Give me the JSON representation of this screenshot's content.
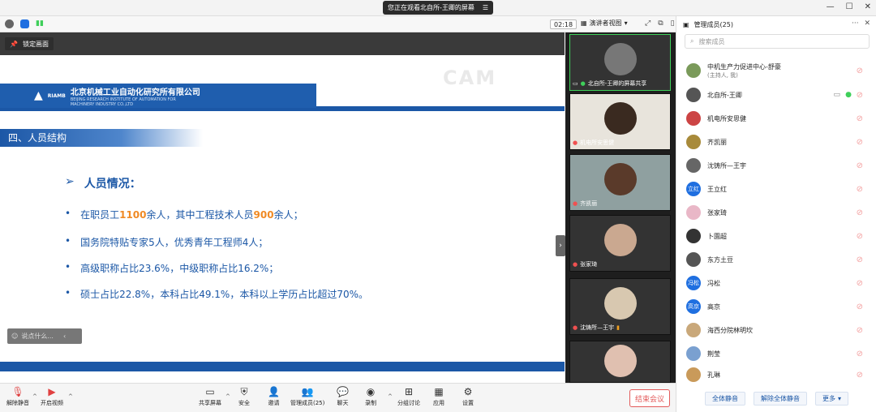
{
  "titlebar": {
    "watching": "您正在观看北自所-王卿的屏幕",
    "menu_icon": "menu-icon"
  },
  "toolbar": {
    "timer": "02:18",
    "view_mode": "演讲者视图"
  },
  "stage": {
    "lock_label": "锁定画面",
    "chat_placeholder": "说点什么..."
  },
  "slide": {
    "company_cn": "北京机械工业自动化研究所有限公司",
    "company_en1": "BEIJING RESEARCH INSTITUTE OF AUTOMATION FOR",
    "company_en2": "MACHINERY INDUSTRY CO.,LTD",
    "logo_text": "RIAMB",
    "watermark": "CAM",
    "section": "四、人员结构",
    "heading_marker": "➢",
    "heading": "人员情况：",
    "bullet_marker": "•",
    "b1_pre": "在职员工",
    "b1_n1": "1100",
    "b1_mid": "余人，其中工程技术人员",
    "b1_n2": "900",
    "b1_post": "余人；",
    "b2": "国务院特贴专家5人，优秀青年工程师4人；",
    "b3": "高级职称占比23.6%，中级职称占比16.2%；",
    "b4": "硕士占比22.8%，本科占比49.1%，本科以上学历占比超过70%。"
  },
  "videos": [
    {
      "label": "北自所-王卿的屏幕共享"
    },
    {
      "label": "机电所安思健"
    },
    {
      "label": "齐凯丽"
    },
    {
      "label": "张家琦"
    },
    {
      "label": "沈铸所—王宇"
    },
    {
      "label": ""
    }
  ],
  "panel": {
    "title": "管理成员(25)",
    "search_placeholder": "搜索成员",
    "members": [
      {
        "name": "中机生产力促进中心-舒豪",
        "sub": "(主持人, 我)",
        "color": "#7a9a5a"
      },
      {
        "name": "北自所-王卿",
        "sub": "",
        "color": "#555"
      },
      {
        "name": "机电所安思健",
        "sub": "",
        "color": "#c44"
      },
      {
        "name": "齐凯丽",
        "sub": "",
        "color": "#a88a3a"
      },
      {
        "name": "沈铸所—王宇",
        "sub": "",
        "color": "#666"
      },
      {
        "name": "王立红",
        "sub": "",
        "color": "#1f6fe0",
        "initials": "立红"
      },
      {
        "name": "张家琦",
        "sub": "",
        "color": "#e9b7c7"
      },
      {
        "name": "卜園超",
        "sub": "",
        "color": "#333"
      },
      {
        "name": "东方土豆",
        "sub": "",
        "color": "#555"
      },
      {
        "name": "冯松",
        "sub": "",
        "color": "#1f6fe0",
        "initials": "冯松"
      },
      {
        "name": "高京",
        "sub": "",
        "color": "#1f6fe0",
        "initials": "高京"
      },
      {
        "name": "海西分院林明坎",
        "sub": "",
        "color": "#c9a87a"
      },
      {
        "name": "荆莹",
        "sub": "",
        "color": "#7aa0d0"
      },
      {
        "name": "孔琳",
        "sub": "",
        "color": "#c99a5a"
      }
    ],
    "mute_all": "全体静音",
    "unmute_all": "解除全体静音",
    "more": "更多"
  },
  "bottombar": {
    "unmute": "解除静音",
    "video": "开启视频",
    "share": "共享屏幕",
    "security": "安全",
    "invite": "邀请",
    "members": "管理成员(25)",
    "chat": "聊天",
    "record": "录制",
    "breakout": "分组讨论",
    "apps": "应用",
    "settings": "设置",
    "end": "结束会议"
  }
}
